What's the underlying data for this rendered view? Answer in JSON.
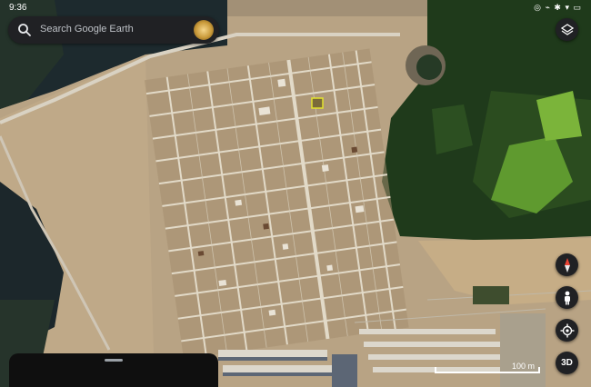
{
  "status_bar": {
    "time": "9:36",
    "system_icons": "◎ ⌁ ✱ ▾ ▭"
  },
  "search": {
    "placeholder": "Search Google Earth",
    "icon": "search-icon",
    "avatar": "profile-avatar"
  },
  "controls": {
    "layers": "layers-icon",
    "compass": "compass-icon",
    "street_view": "pegman-icon",
    "my_location": "my-location-icon",
    "mode_3d_label": "3D"
  },
  "scale": {
    "label": "100 m"
  },
  "bottom_sheet": {
    "handle": "drag-handle"
  },
  "colors": {
    "ui_dark": "#202124",
    "land": "#b9a486",
    "forest": "#1f3a1b",
    "water": "#1d2a2e",
    "highlight": "#e3e32e"
  }
}
